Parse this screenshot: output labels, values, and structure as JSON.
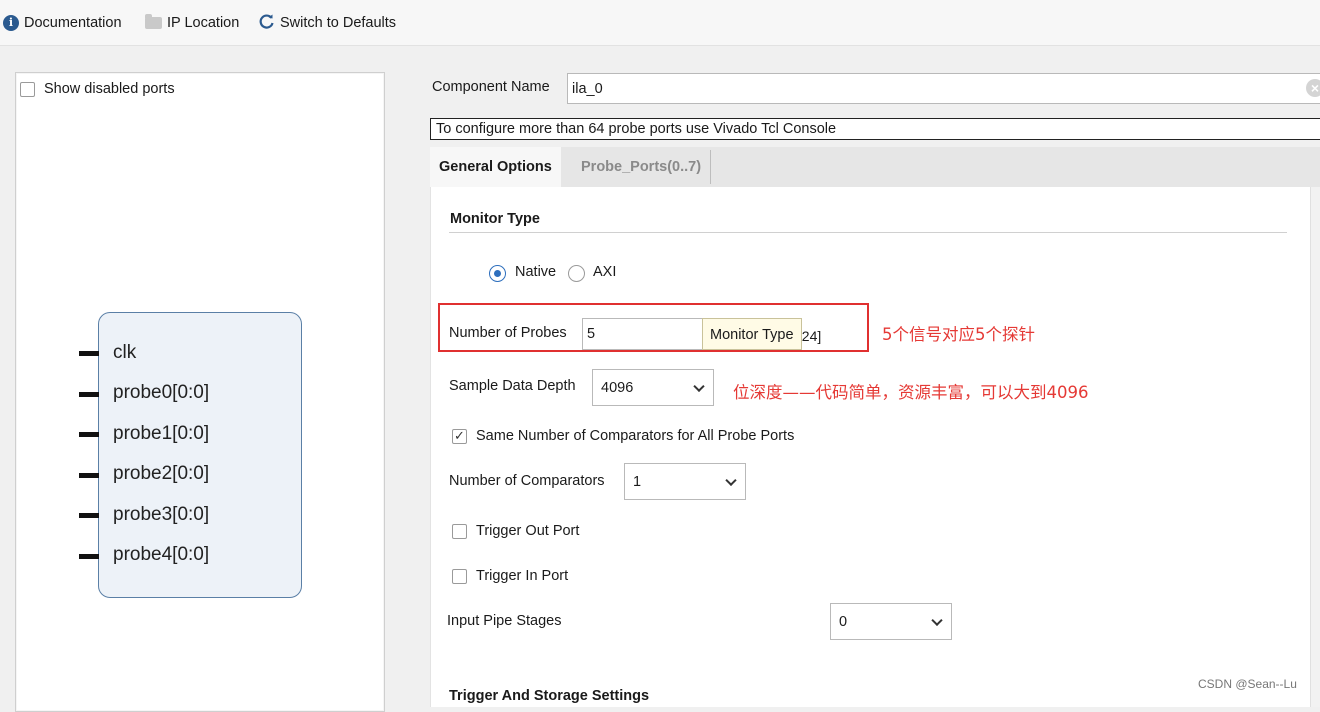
{
  "toolbar": {
    "documentation": "Documentation",
    "documentation_icon": "info-icon",
    "ip_location": "IP Location",
    "ip_location_icon": "folder-icon",
    "switch_defaults": "Switch to Defaults",
    "switch_defaults_icon": "refresh-icon"
  },
  "left_panel": {
    "show_disabled_ports": "Show disabled ports",
    "show_disabled_checked": false,
    "ports": [
      "clk",
      "probe0[0:0]",
      "probe1[0:0]",
      "probe2[0:0]",
      "probe3[0:0]",
      "probe4[0:0]"
    ]
  },
  "component": {
    "label": "Component Name",
    "value": "ila_0"
  },
  "banner": "To configure more than 64 probe ports use Vivado Tcl Console",
  "tabs": [
    {
      "label": "General Options",
      "active": true
    },
    {
      "label": "Probe_Ports(0..7)",
      "active": false
    }
  ],
  "general": {
    "monitor_type_title": "Monitor Type",
    "monitor_native": "Native",
    "monitor_axi": "AXI",
    "monitor_selected": "Native",
    "num_probes_label": "Number of Probes",
    "num_probes_value": "5",
    "num_probes_range_tail": "024]",
    "tooltip": "Monitor Type",
    "sample_depth_label": "Sample Data Depth",
    "sample_depth_value": "4096",
    "same_comparators_label": "Same Number of Comparators for All Probe Ports",
    "same_comparators_checked": true,
    "num_comparators_label": "Number of Comparators",
    "num_comparators_value": "1",
    "trigger_out_label": "Trigger Out Port",
    "trigger_in_label": "Trigger In Port",
    "pipe_stages_label": "Input Pipe Stages",
    "pipe_stages_value": "0",
    "trigger_storage_title": "Trigger And Storage Settings"
  },
  "annotations": {
    "probes_note": "5个信号对应5个探针",
    "depth_note": "位深度——代码简单，资源丰富，可以大到4096"
  },
  "watermark": "CSDN @Sean--Lu",
  "colors": {
    "annotation_red": "#e53935",
    "radio_blue": "#2e6fbd",
    "block_border": "#5a7fa6"
  }
}
